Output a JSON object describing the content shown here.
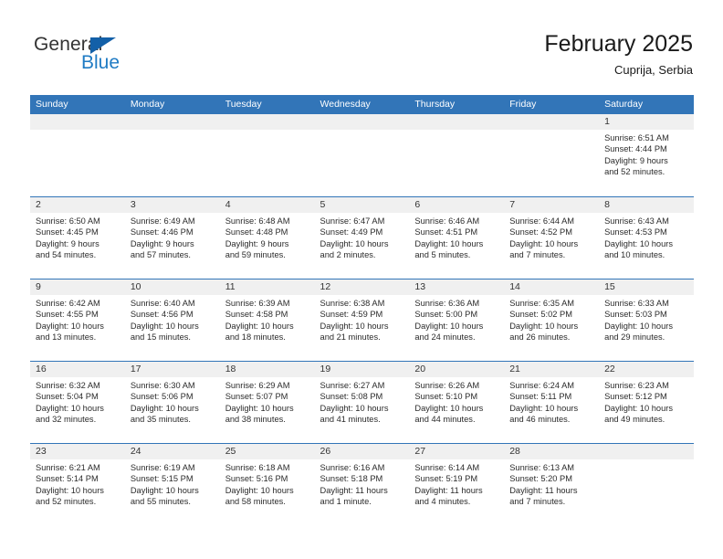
{
  "brand": {
    "name_top": "General",
    "name_bottom": "Blue",
    "accent_color": "#1f7bc4",
    "triangle_color": "#1360a8"
  },
  "header": {
    "title": "February 2025",
    "location": "Cuprija, Serbia"
  },
  "theme": {
    "header_blue": "#3275b8",
    "day_strip_gray": "#f0f0f0",
    "text_color": "#2b2b2b"
  },
  "calendar": {
    "day_headers": [
      "Sunday",
      "Monday",
      "Tuesday",
      "Wednesday",
      "Thursday",
      "Friday",
      "Saturday"
    ],
    "labels": {
      "sunrise": "Sunrise:",
      "sunset": "Sunset:",
      "daylight": "Daylight:"
    },
    "weeks": [
      [
        {
          "day": "",
          "empty": true
        },
        {
          "day": "",
          "empty": true
        },
        {
          "day": "",
          "empty": true
        },
        {
          "day": "",
          "empty": true
        },
        {
          "day": "",
          "empty": true
        },
        {
          "day": "",
          "empty": true
        },
        {
          "day": "1",
          "sunrise": "Sunrise: 6:51 AM",
          "sunset": "Sunset: 4:44 PM",
          "daylight_1": "Daylight: 9 hours",
          "daylight_2": "and 52 minutes."
        }
      ],
      [
        {
          "day": "2",
          "sunrise": "Sunrise: 6:50 AM",
          "sunset": "Sunset: 4:45 PM",
          "daylight_1": "Daylight: 9 hours",
          "daylight_2": "and 54 minutes."
        },
        {
          "day": "3",
          "sunrise": "Sunrise: 6:49 AM",
          "sunset": "Sunset: 4:46 PM",
          "daylight_1": "Daylight: 9 hours",
          "daylight_2": "and 57 minutes."
        },
        {
          "day": "4",
          "sunrise": "Sunrise: 6:48 AM",
          "sunset": "Sunset: 4:48 PM",
          "daylight_1": "Daylight: 9 hours",
          "daylight_2": "and 59 minutes."
        },
        {
          "day": "5",
          "sunrise": "Sunrise: 6:47 AM",
          "sunset": "Sunset: 4:49 PM",
          "daylight_1": "Daylight: 10 hours",
          "daylight_2": "and 2 minutes."
        },
        {
          "day": "6",
          "sunrise": "Sunrise: 6:46 AM",
          "sunset": "Sunset: 4:51 PM",
          "daylight_1": "Daylight: 10 hours",
          "daylight_2": "and 5 minutes."
        },
        {
          "day": "7",
          "sunrise": "Sunrise: 6:44 AM",
          "sunset": "Sunset: 4:52 PM",
          "daylight_1": "Daylight: 10 hours",
          "daylight_2": "and 7 minutes."
        },
        {
          "day": "8",
          "sunrise": "Sunrise: 6:43 AM",
          "sunset": "Sunset: 4:53 PM",
          "daylight_1": "Daylight: 10 hours",
          "daylight_2": "and 10 minutes."
        }
      ],
      [
        {
          "day": "9",
          "sunrise": "Sunrise: 6:42 AM",
          "sunset": "Sunset: 4:55 PM",
          "daylight_1": "Daylight: 10 hours",
          "daylight_2": "and 13 minutes."
        },
        {
          "day": "10",
          "sunrise": "Sunrise: 6:40 AM",
          "sunset": "Sunset: 4:56 PM",
          "daylight_1": "Daylight: 10 hours",
          "daylight_2": "and 15 minutes."
        },
        {
          "day": "11",
          "sunrise": "Sunrise: 6:39 AM",
          "sunset": "Sunset: 4:58 PM",
          "daylight_1": "Daylight: 10 hours",
          "daylight_2": "and 18 minutes."
        },
        {
          "day": "12",
          "sunrise": "Sunrise: 6:38 AM",
          "sunset": "Sunset: 4:59 PM",
          "daylight_1": "Daylight: 10 hours",
          "daylight_2": "and 21 minutes."
        },
        {
          "day": "13",
          "sunrise": "Sunrise: 6:36 AM",
          "sunset": "Sunset: 5:00 PM",
          "daylight_1": "Daylight: 10 hours",
          "daylight_2": "and 24 minutes."
        },
        {
          "day": "14",
          "sunrise": "Sunrise: 6:35 AM",
          "sunset": "Sunset: 5:02 PM",
          "daylight_1": "Daylight: 10 hours",
          "daylight_2": "and 26 minutes."
        },
        {
          "day": "15",
          "sunrise": "Sunrise: 6:33 AM",
          "sunset": "Sunset: 5:03 PM",
          "daylight_1": "Daylight: 10 hours",
          "daylight_2": "and 29 minutes."
        }
      ],
      [
        {
          "day": "16",
          "sunrise": "Sunrise: 6:32 AM",
          "sunset": "Sunset: 5:04 PM",
          "daylight_1": "Daylight: 10 hours",
          "daylight_2": "and 32 minutes."
        },
        {
          "day": "17",
          "sunrise": "Sunrise: 6:30 AM",
          "sunset": "Sunset: 5:06 PM",
          "daylight_1": "Daylight: 10 hours",
          "daylight_2": "and 35 minutes."
        },
        {
          "day": "18",
          "sunrise": "Sunrise: 6:29 AM",
          "sunset": "Sunset: 5:07 PM",
          "daylight_1": "Daylight: 10 hours",
          "daylight_2": "and 38 minutes."
        },
        {
          "day": "19",
          "sunrise": "Sunrise: 6:27 AM",
          "sunset": "Sunset: 5:08 PM",
          "daylight_1": "Daylight: 10 hours",
          "daylight_2": "and 41 minutes."
        },
        {
          "day": "20",
          "sunrise": "Sunrise: 6:26 AM",
          "sunset": "Sunset: 5:10 PM",
          "daylight_1": "Daylight: 10 hours",
          "daylight_2": "and 44 minutes."
        },
        {
          "day": "21",
          "sunrise": "Sunrise: 6:24 AM",
          "sunset": "Sunset: 5:11 PM",
          "daylight_1": "Daylight: 10 hours",
          "daylight_2": "and 46 minutes."
        },
        {
          "day": "22",
          "sunrise": "Sunrise: 6:23 AM",
          "sunset": "Sunset: 5:12 PM",
          "daylight_1": "Daylight: 10 hours",
          "daylight_2": "and 49 minutes."
        }
      ],
      [
        {
          "day": "23",
          "sunrise": "Sunrise: 6:21 AM",
          "sunset": "Sunset: 5:14 PM",
          "daylight_1": "Daylight: 10 hours",
          "daylight_2": "and 52 minutes."
        },
        {
          "day": "24",
          "sunrise": "Sunrise: 6:19 AM",
          "sunset": "Sunset: 5:15 PM",
          "daylight_1": "Daylight: 10 hours",
          "daylight_2": "and 55 minutes."
        },
        {
          "day": "25",
          "sunrise": "Sunrise: 6:18 AM",
          "sunset": "Sunset: 5:16 PM",
          "daylight_1": "Daylight: 10 hours",
          "daylight_2": "and 58 minutes."
        },
        {
          "day": "26",
          "sunrise": "Sunrise: 6:16 AM",
          "sunset": "Sunset: 5:18 PM",
          "daylight_1": "Daylight: 11 hours",
          "daylight_2": "and 1 minute."
        },
        {
          "day": "27",
          "sunrise": "Sunrise: 6:14 AM",
          "sunset": "Sunset: 5:19 PM",
          "daylight_1": "Daylight: 11 hours",
          "daylight_2": "and 4 minutes."
        },
        {
          "day": "28",
          "sunrise": "Sunrise: 6:13 AM",
          "sunset": "Sunset: 5:20 PM",
          "daylight_1": "Daylight: 11 hours",
          "daylight_2": "and 7 minutes."
        },
        {
          "day": "",
          "empty": true
        }
      ]
    ]
  }
}
